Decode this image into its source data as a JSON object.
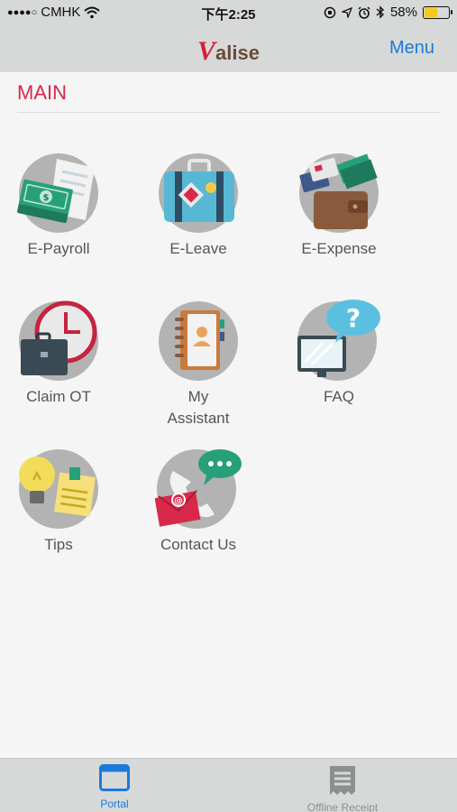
{
  "status_bar": {
    "signal_dots": "●●●●○",
    "carrier": "CMHK",
    "time": "下午2:25",
    "battery_percent": "58%",
    "battery_level": 0.58,
    "icons": [
      "wifi-icon",
      "orientation-lock-icon",
      "location-icon",
      "alarm-icon",
      "bluetooth-icon",
      "battery-icon"
    ]
  },
  "header": {
    "logo_v": "V",
    "logo_rest": "alise",
    "menu_label": "Menu"
  },
  "main": {
    "section_title": "MAIN",
    "tiles": [
      {
        "label": "E-Payroll",
        "icon": "payroll-icon"
      },
      {
        "label": "E-Leave",
        "icon": "suitcase-icon"
      },
      {
        "label": "E-Expense",
        "icon": "wallet-icon"
      },
      {
        "label": "Claim OT",
        "icon": "clock-briefcase-icon"
      },
      {
        "label_line1": "My",
        "label_line2": "Assistant",
        "icon": "address-book-icon"
      },
      {
        "label": "FAQ",
        "icon": "monitor-question-icon"
      },
      {
        "label": "Tips",
        "icon": "lightbulb-note-icon"
      },
      {
        "label": "Contact Us",
        "icon": "phone-mail-icon"
      }
    ]
  },
  "tab_bar": {
    "tabs": [
      {
        "label": "Portal",
        "icon": "portal-icon",
        "active": true
      },
      {
        "label": "Offline Receipt",
        "icon": "receipt-icon",
        "active": false
      }
    ],
    "active_color": "#1b7ad8",
    "inactive_color": "#8d8f8f"
  },
  "colors": {
    "accent": "#d8294a",
    "link": "#1b7ad8",
    "bar_background": "#d7d9d9"
  }
}
